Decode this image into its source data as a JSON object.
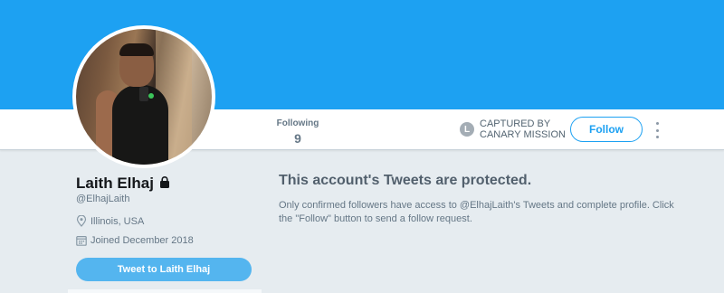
{
  "profile": {
    "name": "Laith Elhaj",
    "handle": "@ElhajLaith",
    "location": "Illinois, USA",
    "joined": "Joined December 2018"
  },
  "nav": {
    "following_label": "Following",
    "following_count": "9",
    "canary_line1": "CAPTURED BY",
    "canary_line2": "CANARY MISSION",
    "canary_icon_letter": "L",
    "follow_label": "Follow"
  },
  "actions": {
    "tweet_to_label": "Tweet to Laith Elhaj"
  },
  "protected": {
    "heading": "This account's Tweets are protected.",
    "description": "Only confirmed followers have access to @ElhajLaith's Tweets and complete profile. Click the \"Follow\" button to send a follow request."
  },
  "icons": {
    "lock": "lock-icon",
    "location": "location-pin-icon",
    "calendar": "calendar-icon",
    "more": "more-vertical-icon"
  },
  "colors": {
    "banner": "#1da1f2",
    "accent": "#1da1f2",
    "tweet_button": "#54b5ef",
    "background": "#e6ecf0"
  }
}
